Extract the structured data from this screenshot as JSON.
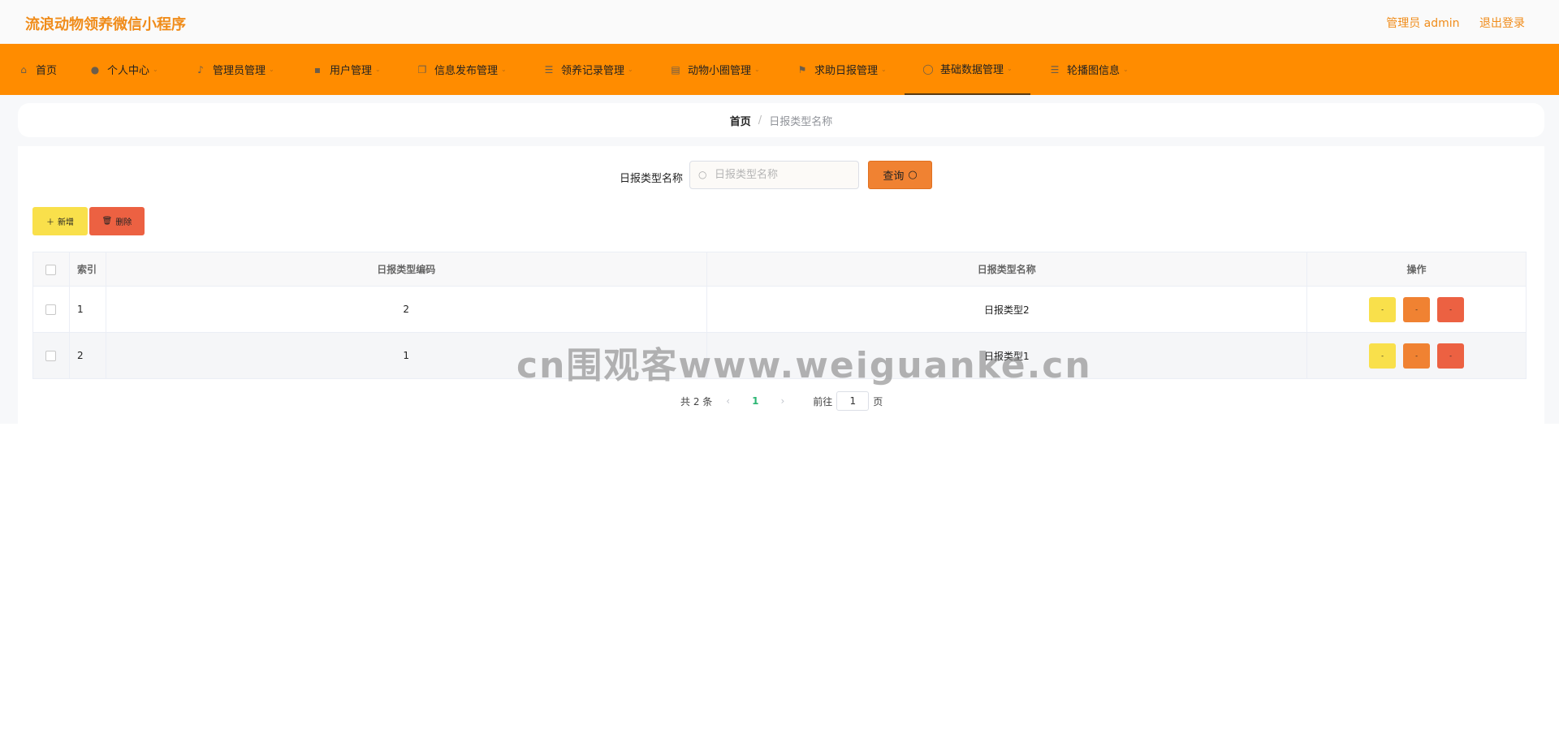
{
  "header": {
    "app_title": "流浪动物领养微信小程序",
    "admin_label": "管理员 admin",
    "logout_label": "退出登录",
    "brand_color": "#f08c1a"
  },
  "nav": {
    "bg_color": "#ff8c00",
    "items": [
      {
        "label": "首页",
        "icon": "home-icon"
      },
      {
        "label": "个人中心",
        "icon": "user-icon"
      },
      {
        "label": "管理员管理",
        "icon": "mic-icon"
      },
      {
        "label": "用户管理",
        "icon": "chat-icon"
      },
      {
        "label": "信息发布管理",
        "icon": "copy-icon"
      },
      {
        "label": "领养记录管理",
        "icon": "list-icon"
      },
      {
        "label": "动物小圈管理",
        "icon": "trash-icon"
      },
      {
        "label": "求助日报管理",
        "icon": "flag-icon"
      },
      {
        "label": "基础数据管理",
        "icon": "circle-icon"
      },
      {
        "label": "轮播图信息",
        "icon": "menu-icon"
      }
    ],
    "active": "基础数据管理"
  },
  "breadcrumb": {
    "home": "首页",
    "separator": "/",
    "current": "日报类型名称"
  },
  "search": {
    "label": "日报类型名称",
    "placeholder": "日报类型名称",
    "value": "",
    "query_label": "查询"
  },
  "actions": {
    "add_label": "新增",
    "delete_label": "删除"
  },
  "table": {
    "columns": [
      "索引",
      "日报类型编码",
      "日报类型名称",
      "操作"
    ],
    "rows": [
      {
        "index": "1",
        "code": "2",
        "name": "日报类型2"
      },
      {
        "index": "2",
        "code": "1",
        "name": "日报类型1"
      }
    ],
    "op_label": "-"
  },
  "pagination": {
    "total_text": "共 2 条",
    "current_page": "1",
    "goto_label": "前往",
    "goto_value": "1",
    "page_suffix": "页"
  },
  "watermark": "cn围观客www.weiguanke.cn"
}
